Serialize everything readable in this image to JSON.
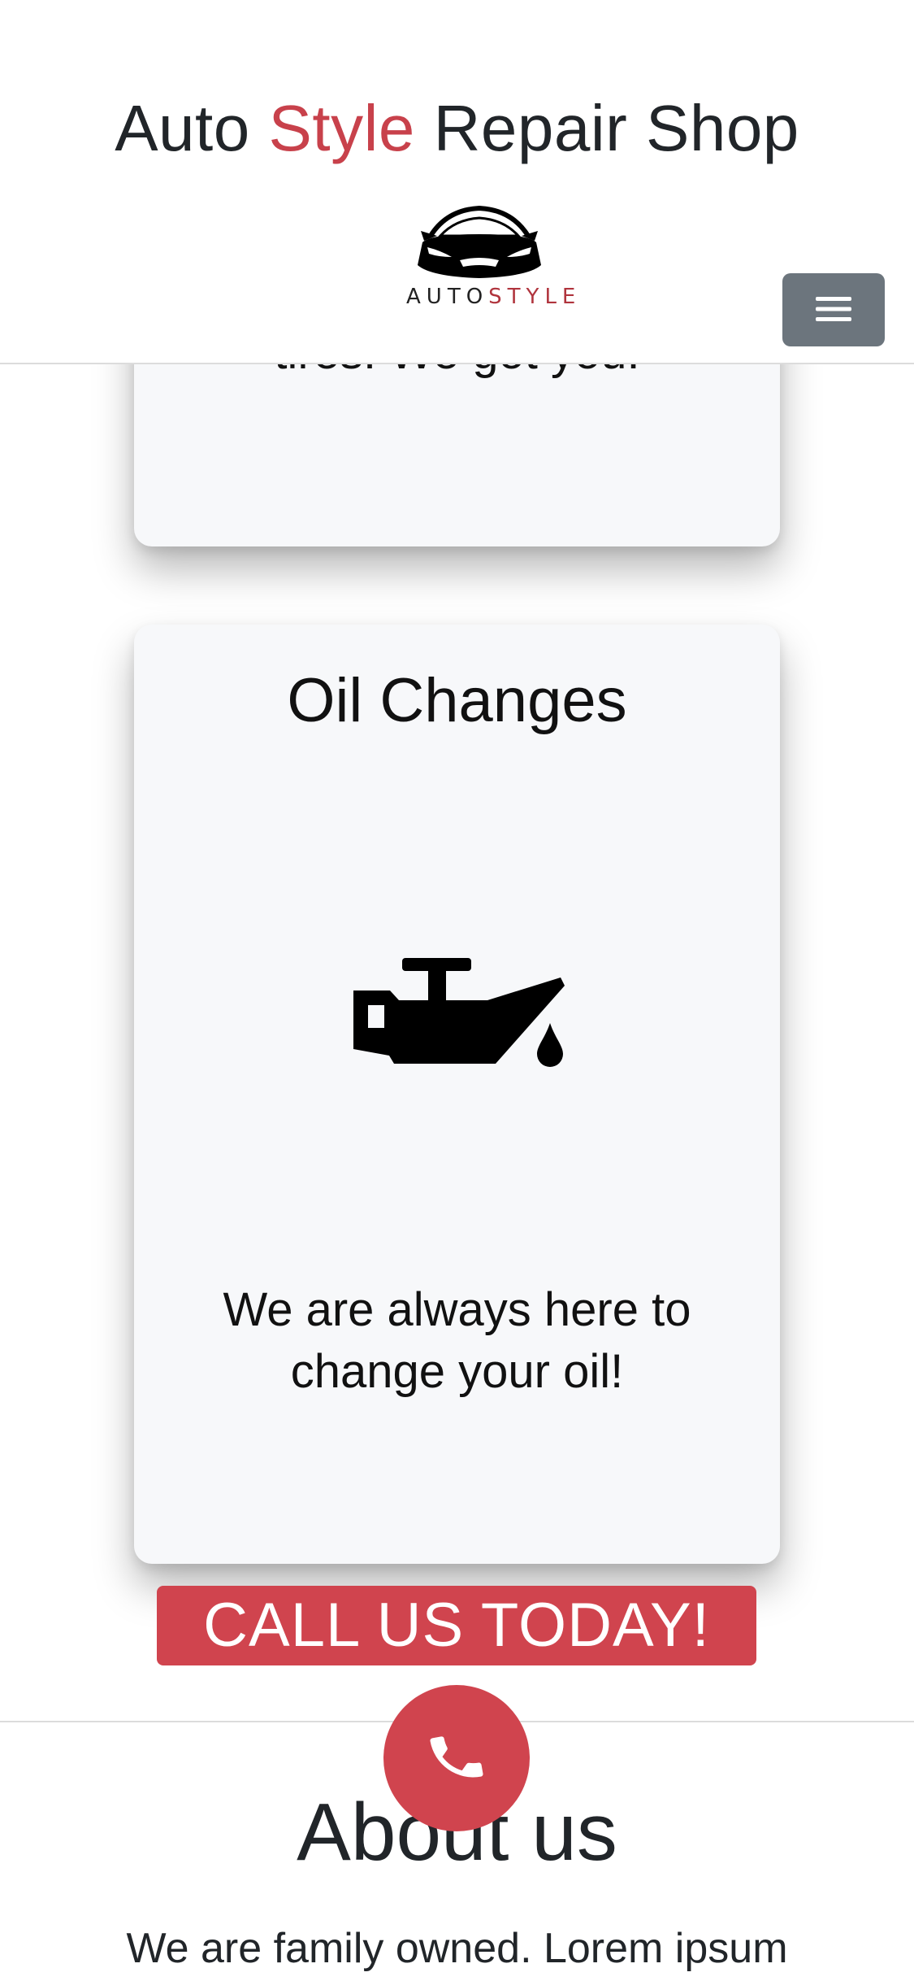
{
  "header": {
    "title_part1": "Auto ",
    "title_accent": "Style",
    "title_part2": " Repair Shop",
    "logo_text_part1": "AUTO",
    "logo_text_part2": "STYLE",
    "menu_icon": "hamburger-menu-icon"
  },
  "services": {
    "previous_card_text": "tires. We got you.",
    "oil_card": {
      "title": "Oil Changes",
      "icon": "oil-can-icon",
      "description": "We are always here to change your oil!"
    }
  },
  "cta": {
    "label": "CALL US TODAY!",
    "phone_icon": "phone-icon"
  },
  "about": {
    "title": "About us",
    "text": "We are family owned. Lorem ipsum"
  },
  "colors": {
    "accent": "#c8414b",
    "cta_bg": "#d0444e",
    "menu_button_bg": "#6c757d",
    "card_bg": "#f7f8fa"
  }
}
